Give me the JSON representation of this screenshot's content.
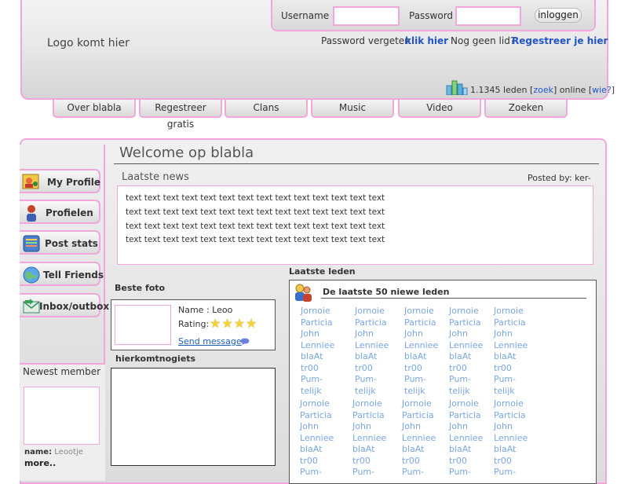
{
  "header": {
    "logo": "Logo komt hier",
    "login": {
      "username_label": "Username",
      "password_label": "Password",
      "username_value": "",
      "password_value": "",
      "login_button": "inloggen"
    },
    "forgot_text": "Password vergeten",
    "forgot_link": "klik hier",
    "no_member_text": "Nog geen lid?",
    "register_link": "Regestreer je hier",
    "stats": {
      "members_text": "1.1345 leden [",
      "search_link": "zoek",
      "online_text": "] online [",
      "who_link": "wie?",
      "close": "]"
    }
  },
  "nav": [
    "Over blabla",
    "Regestreer gratis",
    "Clans",
    "Music",
    "Video",
    "Zoeken"
  ],
  "sidebar": {
    "items": [
      {
        "label": "My Profile",
        "icon": "profile-icon"
      },
      {
        "label": "Profielen",
        "icon": "user-icon"
      },
      {
        "label": "Post stats",
        "icon": "stats-icon"
      },
      {
        "label": "Tell Friends",
        "icon": "globe-icon"
      },
      {
        "label": "Inbox/outbox",
        "icon": "mail-icon"
      }
    ],
    "newest_member": {
      "title": "Newest member",
      "name_label": "name:",
      "name_value": "Leootje",
      "more": "more.."
    }
  },
  "main": {
    "title": "Welcome op blabla",
    "news": {
      "title": "Laatste news",
      "posted_by": "Posted by: ker-",
      "lines": [
        "text text text text text text text text text text text text text text",
        "text text text text text text text text text text text text text text",
        "text text text text text text text text text text text text text text",
        "text text text text text text text text text text text text text text"
      ]
    },
    "best_photo": {
      "title": "Beste foto",
      "name": "Name : Leoo",
      "rating_label": "Rating:",
      "rating_value": 4,
      "stars": "★★★★",
      "send_message": "Send message"
    },
    "hier_title": "hierkomtnogiets",
    "latest_members": {
      "title": "Laatste leden",
      "header": "De laatste 50 niewe leden",
      "columns": [
        [
          "Jornoie",
          "Particia",
          "John",
          "Lenniee",
          "blaAt",
          "tr00",
          "Pum-",
          "telijk"
        ],
        [
          "Jornoie",
          "Particia",
          "John",
          "Lenniee",
          "blaAt",
          "tr00",
          "Pum-",
          "telijk"
        ],
        [
          "Jornoie",
          "Particia",
          "John",
          "Lenniee",
          "blaAt",
          "tr00",
          "Pum-",
          "telijk"
        ],
        [
          "Jornoie",
          "Particia",
          "John",
          "Lenniee",
          "blaAt",
          "tr00",
          "Pum-",
          "telijk"
        ],
        [
          "Jornoie",
          "Particia",
          "John",
          "Lenniee",
          "blaAt",
          "tr00",
          "Pum-",
          "telijk"
        ]
      ],
      "columns_row2": [
        [
          "Jornoie",
          "Particia",
          "John",
          "Lenniee",
          "blaAt",
          "tr00",
          "Pum-"
        ],
        [
          "Jornoie",
          "Particia",
          "John",
          "Lenniee",
          "blaAt",
          "tr00",
          "Pum-"
        ],
        [
          "Jornoie",
          "Particia",
          "John",
          "Lenniee",
          "blaAt",
          "tr00",
          "Pum-"
        ],
        [
          "Jornoie",
          "Particia",
          "John",
          "Lenniee",
          "blaAt",
          "tr00",
          "Pum-"
        ],
        [
          "Jornoie",
          "Particia",
          "John",
          "Lenniee",
          "blaAt",
          "tr00",
          "Pum-"
        ]
      ]
    }
  },
  "colors": {
    "accent_border": "#f0a8da",
    "link": "#2255cc",
    "member_link": "#7aa6de"
  }
}
